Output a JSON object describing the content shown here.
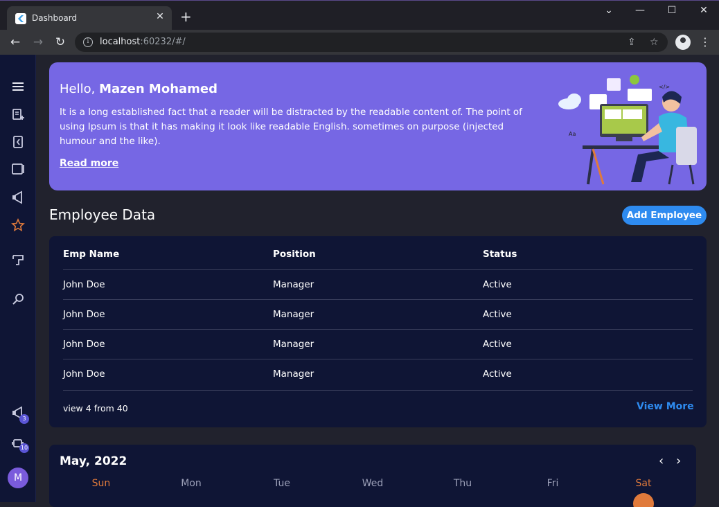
{
  "browser": {
    "tab_title": "Dashboard",
    "tab_close": "✕",
    "new_tab": "+",
    "url_host": "localhost",
    "url_rest": ":60232/#/",
    "window_controls": {
      "minimize": "—",
      "maximize": "☐",
      "close": "✕",
      "tab_search": "⌄"
    }
  },
  "sidebar": {
    "badges": {
      "notifications": "3",
      "devices": "10"
    },
    "avatar_letter": "M",
    "active_color": "#e07a3b"
  },
  "hero": {
    "greeting": "Hello,",
    "name": "Mazen Mohamed",
    "text": "It is a long established fact that a reader will be distracted by the readable content of. The point of using Ipsum is that it has making it look like readable English. sometimes on purpose (injected humour and the like).",
    "link": "Read more"
  },
  "employees": {
    "title": "Employee Data",
    "add_button": "Add Employee",
    "headers": {
      "name": "Emp Name",
      "position": "Position",
      "status": "Status"
    },
    "rows": [
      {
        "name": "John Doe",
        "position": "Manager",
        "status": "Active"
      },
      {
        "name": "John Doe",
        "position": "Manager",
        "status": "Active"
      },
      {
        "name": "John Doe",
        "position": "Manager",
        "status": "Active"
      },
      {
        "name": "John Doe",
        "position": "Manager",
        "status": "Active"
      }
    ],
    "footer_count": "view 4 from 40",
    "view_more": "View More"
  },
  "calendar": {
    "title": "May, 2022",
    "prev": "‹",
    "next": "›",
    "days": [
      "Sun",
      "Mon",
      "Tue",
      "Wed",
      "Thu",
      "Fri",
      "Sat"
    ]
  }
}
